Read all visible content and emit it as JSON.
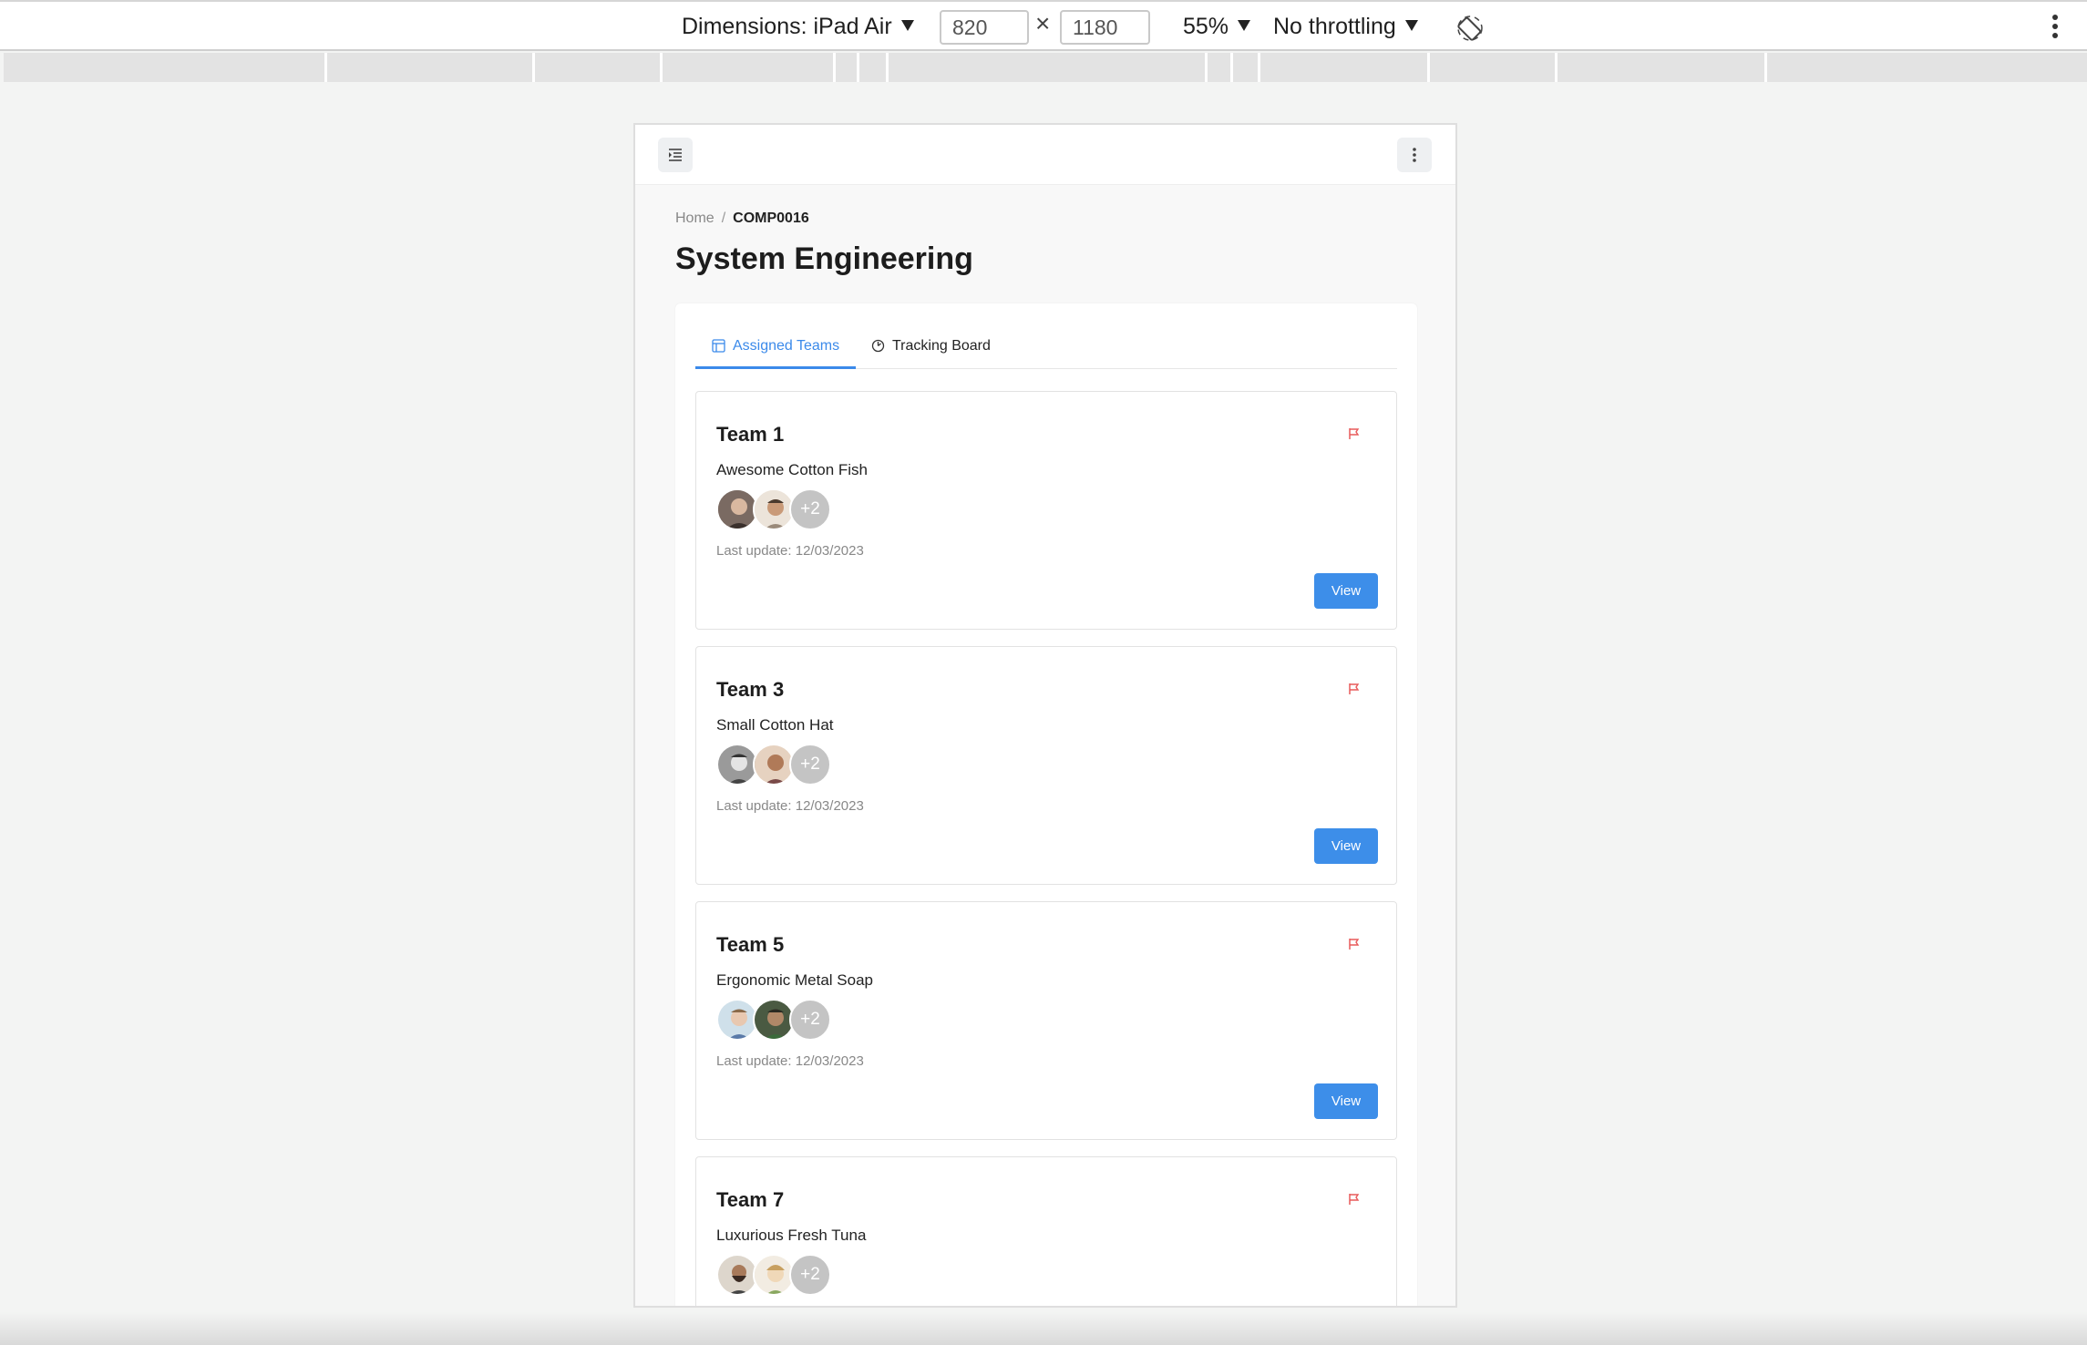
{
  "devtools": {
    "dimensions_label": "Dimensions: iPad Air",
    "width": "820",
    "height": "1180",
    "times": "×",
    "zoom": "55%",
    "throttling": "No throttling"
  },
  "breadcrumb": {
    "home": "Home",
    "separator": "/",
    "current": "COMP0016"
  },
  "page_title": "System Engineering",
  "tabs": [
    {
      "label": "Assigned Teams",
      "icon": "board-icon",
      "active": true
    },
    {
      "label": "Tracking Board",
      "icon": "gauge-icon",
      "active": false
    }
  ],
  "teams": [
    {
      "name": "Team 1",
      "product": "Awesome Cotton Fish",
      "extra_members": "+2",
      "last_update": "Last update: 12/03/2023",
      "view_label": "View"
    },
    {
      "name": "Team 3",
      "product": "Small Cotton Hat",
      "extra_members": "+2",
      "last_update": "Last update: 12/03/2023",
      "view_label": "View"
    },
    {
      "name": "Team 5",
      "product": "Ergonomic Metal Soap",
      "extra_members": "+2",
      "last_update": "Last update: 12/03/2023",
      "view_label": "View"
    },
    {
      "name": "Team 7",
      "product": "Luxurious Fresh Tuna",
      "extra_members": "+2",
      "last_update": "",
      "view_label": ""
    }
  ],
  "colors": {
    "accent": "#3d8ee9",
    "flag": "#e85a5a"
  }
}
